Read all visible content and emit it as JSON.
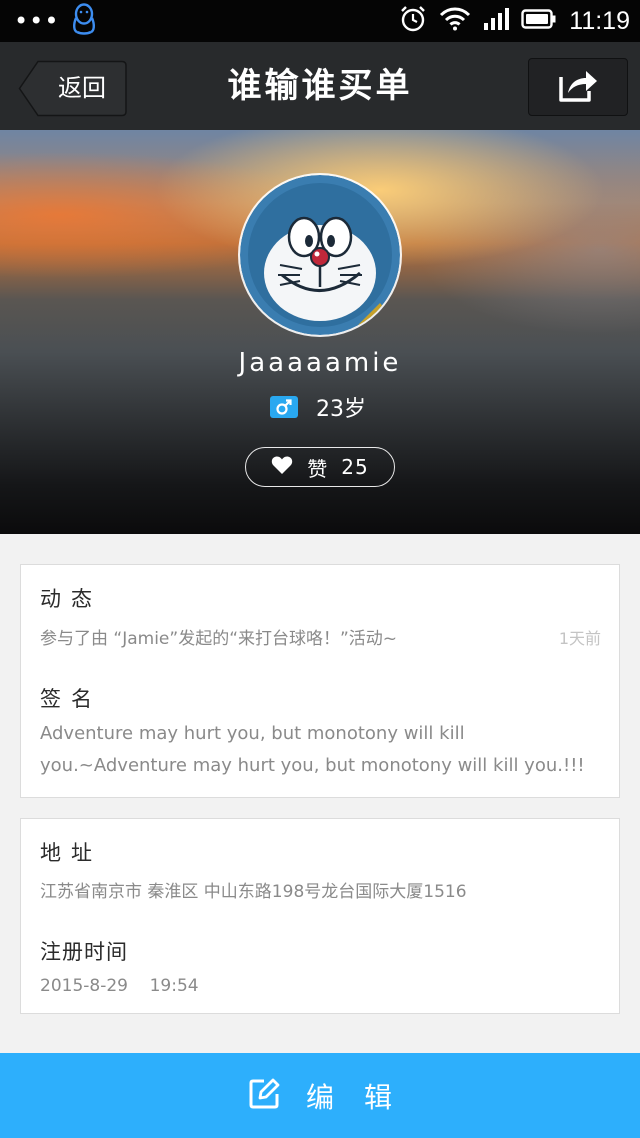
{
  "status_bar": {
    "time": "11:19",
    "icons": [
      "more-dots-icon",
      "qq-penguin-icon",
      "alarm-icon",
      "wifi-icon",
      "signal-icon",
      "battery-icon"
    ]
  },
  "nav": {
    "back_label": "返回",
    "title": "谁输谁买单",
    "share_icon": "share-icon"
  },
  "profile": {
    "username": "Jaaaaamie",
    "gender_icon": "male-icon",
    "age": "23岁",
    "like_label": "赞",
    "like_count": "25"
  },
  "activity": {
    "title": "动态",
    "text": "参与了由 “Jamie”发起的“来打台球咯！”活动~",
    "time_ago": "1天前"
  },
  "signature": {
    "title": "签名",
    "text": "Adventure may hurt you, but monotony will kill you.~Adventure may hurt you, but monotony will kill you.!!!"
  },
  "address": {
    "title": "地址",
    "text": "江苏省南京市 秦淮区 中山东路198号龙台国际大厦1516"
  },
  "register_time": {
    "title": "注册时间",
    "text": "2015-8-29    19:54"
  },
  "edit_button": {
    "label": "编辑"
  },
  "colors": {
    "accent": "#2daffc",
    "nav_bg": "#282a2c",
    "gender_badge": "#29a8f0"
  }
}
